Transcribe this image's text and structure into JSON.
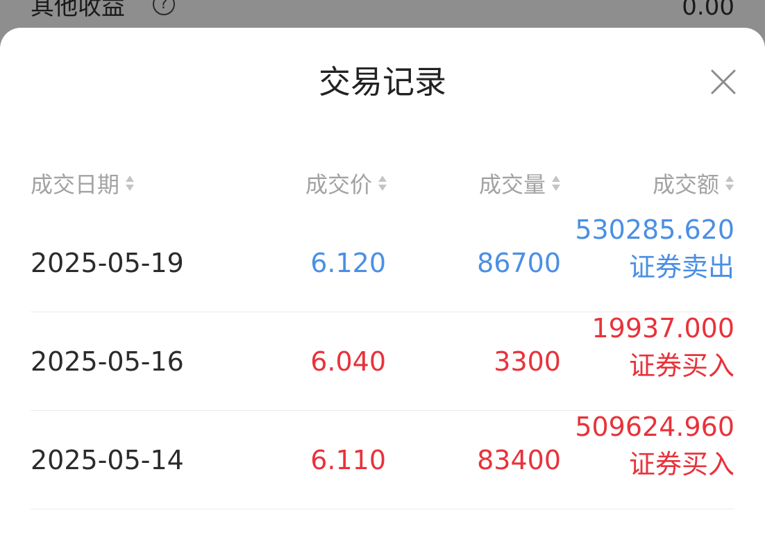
{
  "background": {
    "label": "其他收益",
    "help_glyph": "?",
    "value": "0.00"
  },
  "sheet": {
    "title": "交易记录"
  },
  "table": {
    "headers": [
      "成交日期",
      "成交价",
      "成交量",
      "成交额"
    ],
    "rows": [
      {
        "date": "2025-05-19",
        "price": "6.120",
        "volume": "86700",
        "amount": "530285.620",
        "type": "证券卖出",
        "direction": "sell"
      },
      {
        "date": "2025-05-16",
        "price": "6.040",
        "volume": "3300",
        "amount": "19937.000",
        "type": "证券买入",
        "direction": "buy"
      },
      {
        "date": "2025-05-14",
        "price": "6.110",
        "volume": "83400",
        "amount": "509624.960",
        "type": "证券买入",
        "direction": "buy"
      }
    ]
  },
  "colors": {
    "sell": "#4a8fe4",
    "buy": "#e8323a",
    "header_text": "#a2a2a2",
    "overlay": "#8e8e8e"
  },
  "icons": {
    "close": "close-icon",
    "sort": "sort-icon",
    "help": "help-circle-icon"
  }
}
